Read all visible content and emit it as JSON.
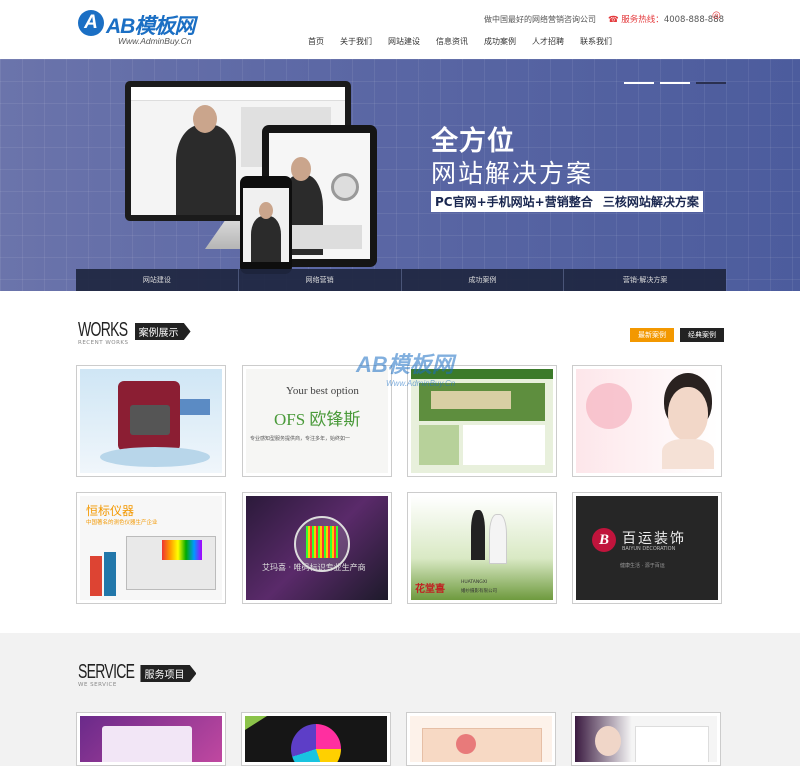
{
  "header": {
    "logo_mark": "A",
    "logo_text": "AB模板网",
    "logo_url": "Www.AdminBuy.Cn",
    "slogan": "做中国最好的网络营销咨询公司",
    "hotline_label": "服务热线：",
    "hotline_number": "4008-888-888"
  },
  "nav": [
    "首页",
    "关于我们",
    "网站建设",
    "信息资讯",
    "成功案例",
    "人才招聘",
    "联系我们"
  ],
  "banner": {
    "headline1": "全方位",
    "headline2": "网站解决方案",
    "headline3_a": "PC官网+手机网站+营销整合",
    "headline3_b": "三核网站解决方案",
    "tabs": [
      "网站建设",
      "网络营销",
      "成功案例",
      "营销-解决方案"
    ],
    "slide_count": 3,
    "active_slide": 1
  },
  "works": {
    "title_en": "WORKS",
    "title_cn": "案例展示",
    "subtitle": "RECENT WORKS",
    "tabs": [
      "最新案例",
      "经典案例"
    ],
    "watermark_main": "AB模板网",
    "watermark_url": "Www.AdminBuy.Cn",
    "items": [
      {
        "name": "printer-machine",
        "text": ""
      },
      {
        "name": "ofs-brand",
        "text_a": "Your best option",
        "text_b": "OFS 欧锋斯",
        "text_c": "专业感知型服务提供商，专注多年，始终如一"
      },
      {
        "name": "green-website",
        "text": ""
      },
      {
        "name": "beauty-woman",
        "text": ""
      },
      {
        "name": "instrument",
        "text_a": "恒标仪器",
        "text_b": "中国著名的测色仪器生产企业"
      },
      {
        "name": "ai-ma-xi",
        "text": "艾玛喜 · 唯码标识专业生产商"
      },
      {
        "name": "wedding",
        "text_a": "花堂喜",
        "text_b": "HUATANGXI",
        "text_c": "婚纱摄影有限公司"
      },
      {
        "name": "baiyun",
        "text_a": "百运装饰",
        "text_b": "BAIYUN DECORATION",
        "text_c": "健康生活 · 源于百运"
      }
    ]
  },
  "service": {
    "title_en": "SERVICE",
    "title_cn": "服务项目",
    "subtitle": "WE SERVICE"
  },
  "colors": {
    "brand_blue": "#1b6fc4",
    "accent_orange": "#f39800",
    "hotline_red": "#e4393c",
    "banner_blue": "#5c68a5"
  }
}
